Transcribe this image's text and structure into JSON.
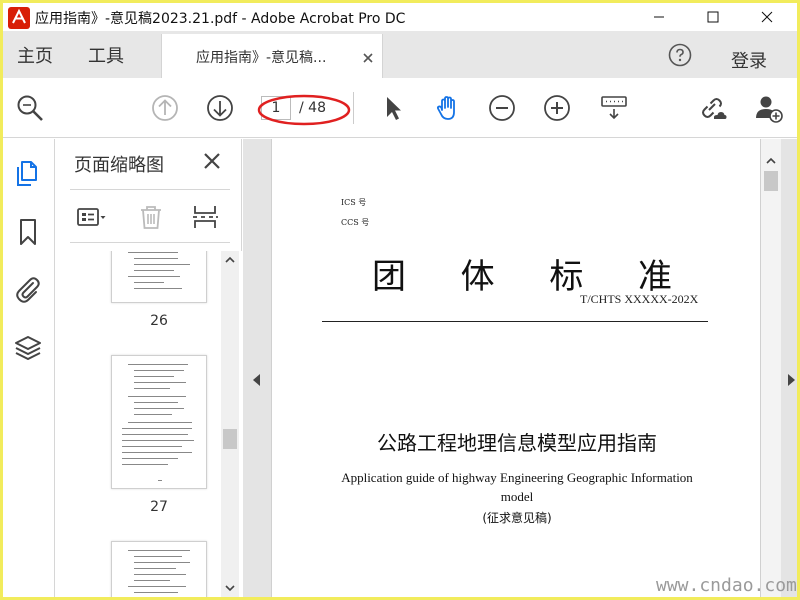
{
  "window": {
    "title": "应用指南》-意见稿2023.21.pdf - Adobe Acrobat Pro DC"
  },
  "tabbar": {
    "home": "主页",
    "tools": "工具",
    "doc_tab": "应用指南》-意见稿...",
    "login": "登录"
  },
  "toolbar": {
    "current_page": "1",
    "total_pages": "/ 48"
  },
  "thumb_panel": {
    "title": "页面缩略图",
    "pages": [
      "26",
      "27"
    ]
  },
  "document": {
    "ics": "ICS  号",
    "ccs": "CCS  号",
    "big_title": [
      "团",
      "体",
      "标",
      "准"
    ],
    "std_no": "T/CHTS XXXXX-202X",
    "cn_title": "公路工程地理信息模型应用指南",
    "en_title": "Application guide of highway Engineering Geographic Information model",
    "draft": "(征求意见稿)"
  },
  "watermark": "www.cndao.com",
  "colors": {
    "accent_blue": "#1473e6",
    "annotation_red": "#e02020",
    "frame_yellow": "#f2ec5c"
  }
}
